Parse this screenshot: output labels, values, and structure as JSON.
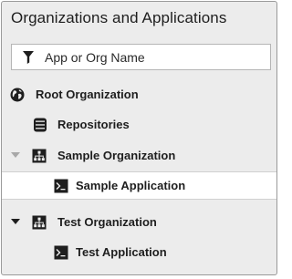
{
  "panel": {
    "title": "Organizations and Applications"
  },
  "filter": {
    "placeholder": "App or Org Name",
    "value": "",
    "icon": "filter-icon"
  },
  "tree": {
    "items": [
      {
        "label": "Root Organization",
        "icon": "globe-icon",
        "expanded": true
      },
      {
        "label": "Repositories",
        "icon": "database-icon"
      },
      {
        "label": "Sample Organization",
        "icon": "org-chart-icon",
        "expanded": true
      },
      {
        "label": "Sample Application",
        "icon": "terminal-icon",
        "selected": true
      },
      {
        "label": "Test Organization",
        "icon": "org-chart-icon",
        "expanded": true
      },
      {
        "label": "Test Application",
        "icon": "terminal-icon"
      }
    ]
  }
}
